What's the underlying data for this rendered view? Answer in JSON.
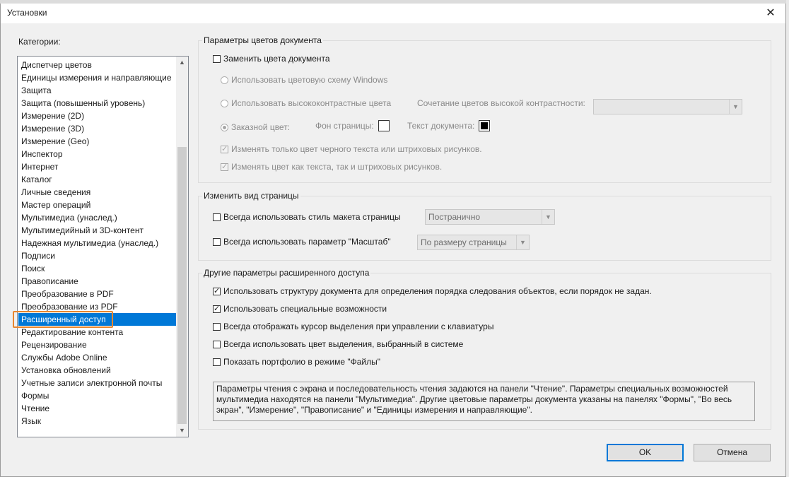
{
  "dialog": {
    "title": "Установки",
    "close_glyph": "✕"
  },
  "categories": {
    "label": "Категории:",
    "items": [
      "Диспетчер цветов",
      "Единицы измерения и направляющие",
      "Защита",
      "Защита (повышенный уровень)",
      "Измерение (2D)",
      "Измерение (3D)",
      "Измерение (Geo)",
      "Инспектор",
      "Интернет",
      "Каталог",
      "Личные сведения",
      "Мастер операций",
      "Мультимедиа (унаслед.)",
      "Мультимедийный и 3D-контент",
      "Надежная мультимедиа (унаслед.)",
      "Подписи",
      "Поиск",
      "Правописание",
      "Преобразование в PDF",
      "Преобразование из PDF",
      "Расширенный доступ",
      "Редактирование контента",
      "Рецензирование",
      "Службы Adobe Online",
      "Установка обновлений",
      "Учетные записи электронной почты",
      "Формы",
      "Чтение",
      "Язык"
    ],
    "selected": "Расширенный доступ"
  },
  "doc_colors": {
    "title": "Параметры цветов документа",
    "replace_colors": "Заменить цвета документа",
    "use_windows_scheme": "Использовать цветовую схему Windows",
    "use_high_contrast": "Использовать высококонтрастные цвета",
    "high_contrast_combo_label": "Сочетание цветов высокой контрастности:",
    "custom_color": "Заказной цвет:",
    "page_bg": "Фон страницы:",
    "doc_text": "Текст документа:",
    "only_black_text": "Изменять только цвет черного текста или штриховых рисунков.",
    "text_and_line": "Изменять цвет как текста, так и штриховых рисунков."
  },
  "page_view": {
    "title": "Изменить вид страницы",
    "always_layout": "Всегда использовать стиль макета страницы",
    "layout_value": "Постранично",
    "always_zoom": "Всегда использовать параметр \"Масштаб\"",
    "zoom_value": "По размеру страницы"
  },
  "other": {
    "title": "Другие параметры расширенного доступа",
    "opt1": "Использовать структуру документа для определения порядка следования объектов, если порядок не задан.",
    "opt2": "Использовать специальные возможности",
    "opt3": "Всегда отображать курсор выделения при управлении с клавиатуры",
    "opt4": "Всегда использовать цвет выделения, выбранный в системе",
    "opt5": "Показать портфолио в режиме \"Файлы\"",
    "info": "Параметры чтения с экрана и последовательность чтения задаются на панели \"Чтение\". Параметры специальных возможностей мультимедиа находятся на панели \"Мультимедиа\". Другие цветовые параметры документа указаны на панелях \"Формы\", \"Во весь экран\", \"Измерение\", \"Правописание\" и \"Единицы измерения и направляющие\"."
  },
  "buttons": {
    "ok": "OK",
    "cancel": "Отмена"
  }
}
